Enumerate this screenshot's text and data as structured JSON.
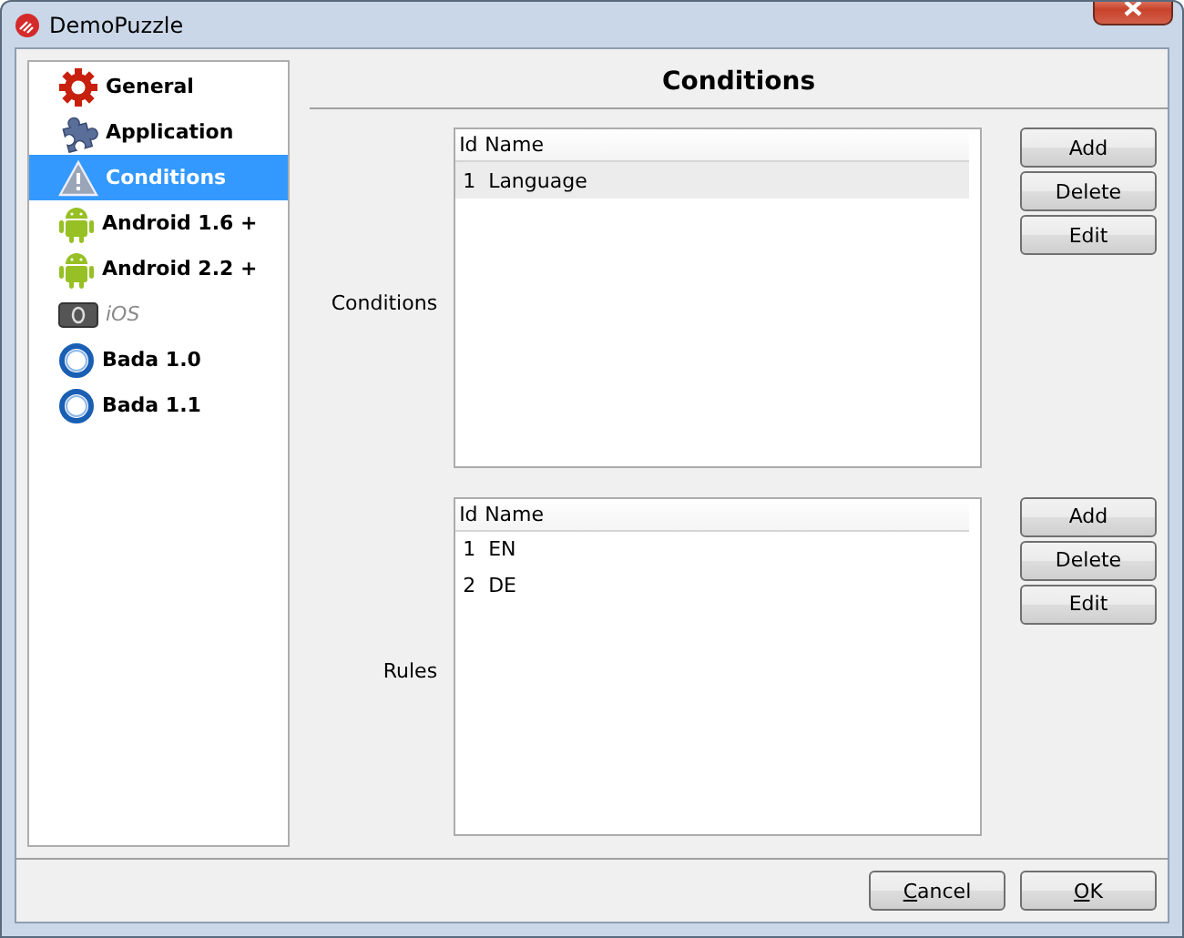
{
  "window": {
    "title": "DemoPuzzle"
  },
  "sidebar": {
    "items": [
      {
        "label": "General",
        "kind": "gear",
        "selected": false,
        "disabled": false
      },
      {
        "label": "Application",
        "kind": "puzzle",
        "selected": false,
        "disabled": false
      },
      {
        "label": "Conditions",
        "kind": "warning",
        "selected": true,
        "disabled": false
      },
      {
        "label": "Android 1.6 +",
        "kind": "android",
        "selected": false,
        "disabled": false
      },
      {
        "label": "Android 2.2 +",
        "kind": "android",
        "selected": false,
        "disabled": false
      },
      {
        "label": "iOS",
        "kind": "ios",
        "selected": false,
        "disabled": true
      },
      {
        "label": "Bada 1.0",
        "kind": "bada",
        "selected": false,
        "disabled": false
      },
      {
        "label": "Bada 1.1",
        "kind": "bada",
        "selected": false,
        "disabled": false
      }
    ]
  },
  "page": {
    "title": "Conditions",
    "sections": [
      {
        "label": "Conditions",
        "columns": [
          "Id",
          "Name"
        ],
        "rows": [
          {
            "cells": [
              "1",
              "Language"
            ],
            "selected": true
          }
        ],
        "buttons": [
          "Add",
          "Delete",
          "Edit"
        ]
      },
      {
        "label": "Rules",
        "columns": [
          "Id",
          "Name"
        ],
        "rows": [
          {
            "cells": [
              "1",
              "EN"
            ],
            "selected": false
          },
          {
            "cells": [
              "2",
              "DE"
            ],
            "selected": false
          }
        ],
        "buttons": [
          "Add",
          "Delete",
          "Edit"
        ]
      }
    ]
  },
  "footer": {
    "buttons": [
      "Cancel",
      "OK"
    ]
  }
}
